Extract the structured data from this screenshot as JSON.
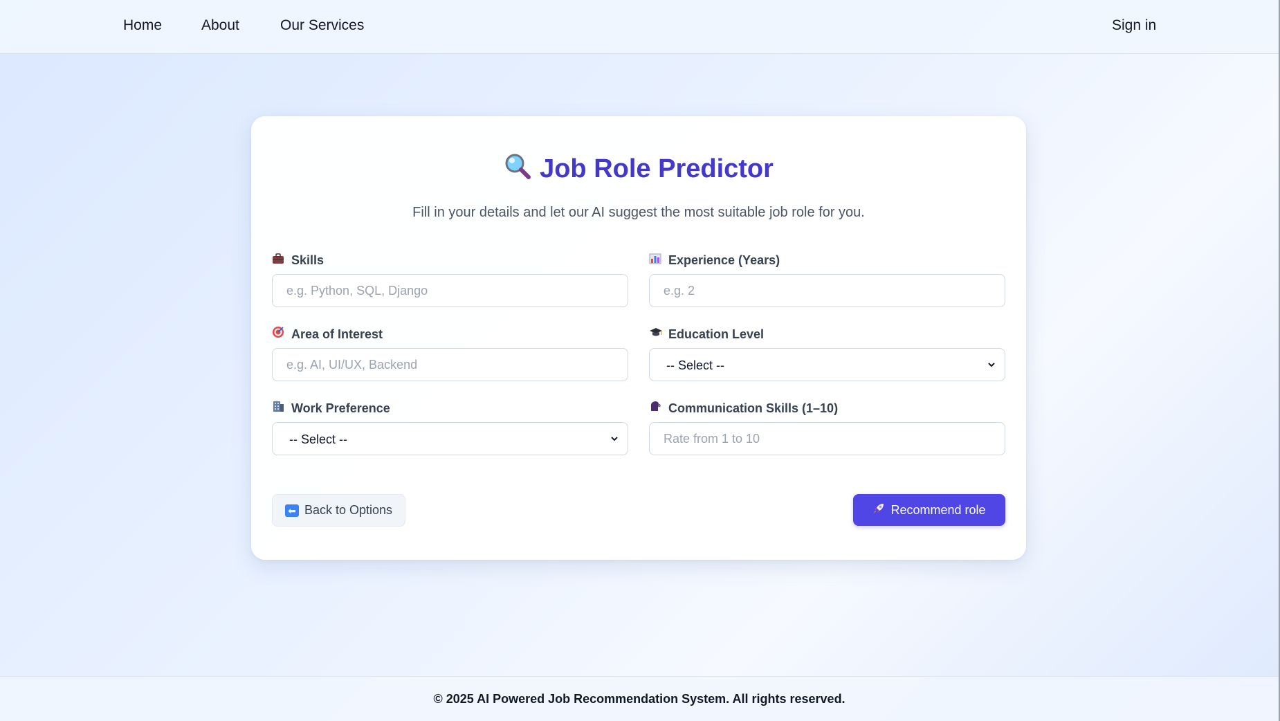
{
  "nav": {
    "home": "Home",
    "about": "About",
    "services": "Our Services",
    "signin": "Sign in"
  },
  "card": {
    "title_icon": "magnifier-icon",
    "title": "Job Role Predictor",
    "subtitle": "Fill in your details and let our AI suggest the most suitable job role for you."
  },
  "form": {
    "skills": {
      "icon": "briefcase-icon",
      "label": "Skills",
      "placeholder": "e.g. Python, SQL, Django",
      "value": ""
    },
    "experience": {
      "icon": "bar-chart-icon",
      "label": "Experience (Years)",
      "placeholder": "e.g. 2",
      "value": ""
    },
    "interest": {
      "icon": "target-icon",
      "label": "Area of Interest",
      "placeholder": "e.g. AI, UI/UX, Backend",
      "value": ""
    },
    "education": {
      "icon": "graduation-cap-icon",
      "label": "Education Level",
      "selected": "-- Select --"
    },
    "work": {
      "icon": "office-building-icon",
      "label": "Work Preference",
      "selected": "-- Select --"
    },
    "communication": {
      "icon": "speaking-head-icon",
      "label": "Communication Skills (1–10)",
      "placeholder": "Rate from 1 to 10",
      "value": ""
    }
  },
  "buttons": {
    "back_icon": "left-arrow-icon",
    "back": "Back to Options",
    "recommend_icon": "rocket-icon",
    "recommend": "Recommend role"
  },
  "footer": {
    "text": "© 2025 AI Powered Job Recommendation System. All rights reserved."
  },
  "colors": {
    "accent": "#4f46e5",
    "title": "#4338ca"
  }
}
